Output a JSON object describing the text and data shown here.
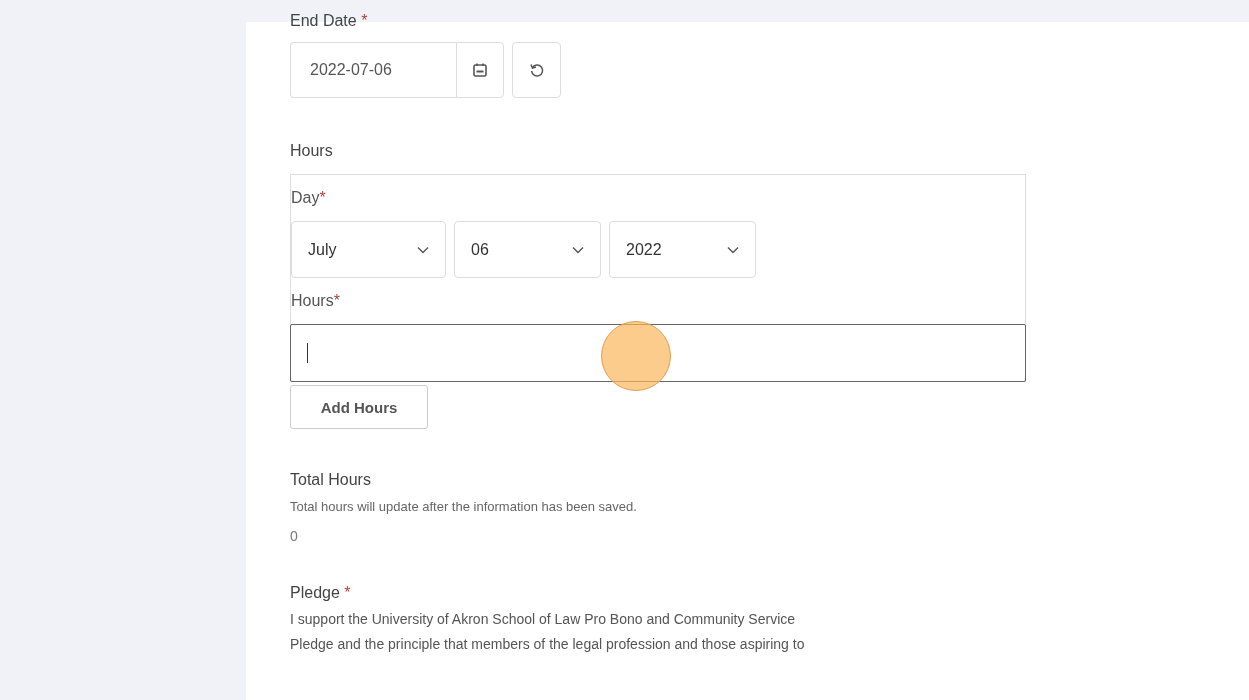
{
  "end_date": {
    "label": "End Date",
    "required_mark": "*",
    "value": "2022-07-06"
  },
  "hours": {
    "title": "Hours",
    "day_label": "Day",
    "day_required": "*",
    "selects": [
      {
        "value": "July"
      },
      {
        "value": "06"
      },
      {
        "value": "2022"
      }
    ],
    "hours_label": "Hours",
    "hours_required": "*",
    "hours_focused": true,
    "add_button": "Add Hours"
  },
  "total_hours": {
    "title": "Total Hours",
    "note": "Total hours will update after the information has been saved.",
    "value": "0"
  },
  "pledge": {
    "label": "Pledge",
    "required_mark": "*",
    "lines": [
      "I support the University of Akron School of Law Pro Bono and Community Service",
      "Pledge and the principle that members of the legal profession and those aspiring to"
    ]
  }
}
